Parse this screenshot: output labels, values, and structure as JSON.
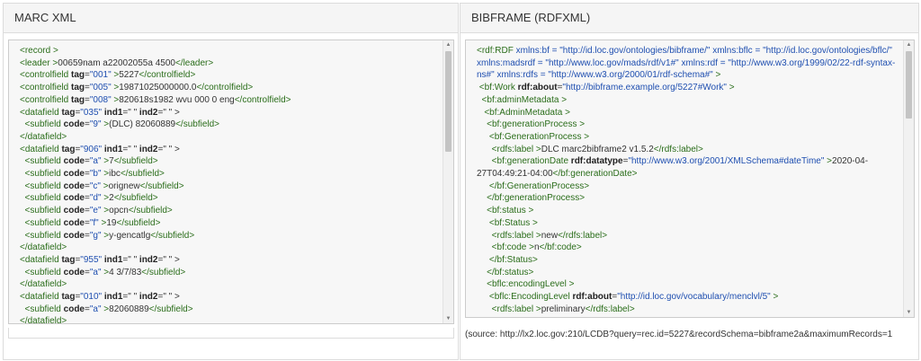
{
  "left": {
    "title": "MARC XML",
    "lines": [
      [
        [
          "t",
          "<record >"
        ]
      ],
      [
        [
          "t",
          "<leader >"
        ],
        [
          "x",
          "00659nam a22002055a 4500"
        ],
        [
          "t",
          "</leader>"
        ]
      ],
      [
        [
          "t",
          "<controlfield "
        ],
        [
          "a",
          "tag"
        ],
        [
          "x",
          "="
        ],
        [
          "v",
          "\"001\""
        ],
        [
          "t",
          " >"
        ],
        [
          "x",
          "5227"
        ],
        [
          "t",
          "</controlfield>"
        ]
      ],
      [
        [
          "t",
          "<controlfield "
        ],
        [
          "a",
          "tag"
        ],
        [
          "x",
          "="
        ],
        [
          "v",
          "\"005\""
        ],
        [
          "t",
          " >"
        ],
        [
          "x",
          "19871025000000.0"
        ],
        [
          "t",
          "</controlfield>"
        ]
      ],
      [
        [
          "t",
          "<controlfield "
        ],
        [
          "a",
          "tag"
        ],
        [
          "x",
          "="
        ],
        [
          "v",
          "\"008\""
        ],
        [
          "t",
          " >"
        ],
        [
          "x",
          "820618s1982 wvu 000 0 eng"
        ],
        [
          "t",
          "</controlfield>"
        ]
      ],
      [
        [
          "t",
          "<datafield "
        ],
        [
          "a",
          "tag"
        ],
        [
          "x",
          "="
        ],
        [
          "v",
          "\"035\""
        ],
        [
          "a",
          " ind1"
        ],
        [
          "x",
          "=\" \" "
        ],
        [
          "a",
          "ind2"
        ],
        [
          "x",
          "=\" \" >"
        ]
      ],
      [
        [
          "t",
          "  <subfield "
        ],
        [
          "a",
          "code"
        ],
        [
          "x",
          "="
        ],
        [
          "v",
          "\"9\""
        ],
        [
          "t",
          " >"
        ],
        [
          "x",
          "(DLC) 82060889"
        ],
        [
          "t",
          "</subfield>"
        ]
      ],
      [
        [
          "t",
          "</datafield>"
        ]
      ],
      [
        [
          "t",
          "<datafield "
        ],
        [
          "a",
          "tag"
        ],
        [
          "x",
          "="
        ],
        [
          "v",
          "\"906\""
        ],
        [
          "a",
          " ind1"
        ],
        [
          "x",
          "=\" \" "
        ],
        [
          "a",
          "ind2"
        ],
        [
          "x",
          "=\" \" >"
        ]
      ],
      [
        [
          "t",
          "  <subfield "
        ],
        [
          "a",
          "code"
        ],
        [
          "x",
          "="
        ],
        [
          "v",
          "\"a\""
        ],
        [
          "t",
          " >"
        ],
        [
          "x",
          "7"
        ],
        [
          "t",
          "</subfield>"
        ]
      ],
      [
        [
          "t",
          "  <subfield "
        ],
        [
          "a",
          "code"
        ],
        [
          "x",
          "="
        ],
        [
          "v",
          "\"b\""
        ],
        [
          "t",
          " >"
        ],
        [
          "x",
          "ibc"
        ],
        [
          "t",
          "</subfield>"
        ]
      ],
      [
        [
          "t",
          "  <subfield "
        ],
        [
          "a",
          "code"
        ],
        [
          "x",
          "="
        ],
        [
          "v",
          "\"c\""
        ],
        [
          "t",
          " >"
        ],
        [
          "x",
          "orignew"
        ],
        [
          "t",
          "</subfield>"
        ]
      ],
      [
        [
          "t",
          "  <subfield "
        ],
        [
          "a",
          "code"
        ],
        [
          "x",
          "="
        ],
        [
          "v",
          "\"d\""
        ],
        [
          "t",
          " >"
        ],
        [
          "x",
          "2"
        ],
        [
          "t",
          "</subfield>"
        ]
      ],
      [
        [
          "t",
          "  <subfield "
        ],
        [
          "a",
          "code"
        ],
        [
          "x",
          "="
        ],
        [
          "v",
          "\"e\""
        ],
        [
          "t",
          " >"
        ],
        [
          "x",
          "opcn"
        ],
        [
          "t",
          "</subfield>"
        ]
      ],
      [
        [
          "t",
          "  <subfield "
        ],
        [
          "a",
          "code"
        ],
        [
          "x",
          "="
        ],
        [
          "v",
          "\"f\""
        ],
        [
          "t",
          " >"
        ],
        [
          "x",
          "19"
        ],
        [
          "t",
          "</subfield>"
        ]
      ],
      [
        [
          "t",
          "  <subfield "
        ],
        [
          "a",
          "code"
        ],
        [
          "x",
          "="
        ],
        [
          "v",
          "\"g\""
        ],
        [
          "t",
          " >"
        ],
        [
          "x",
          "y-gencatlg"
        ],
        [
          "t",
          "</subfield>"
        ]
      ],
      [
        [
          "t",
          "</datafield>"
        ]
      ],
      [
        [
          "t",
          "<datafield "
        ],
        [
          "a",
          "tag"
        ],
        [
          "x",
          "="
        ],
        [
          "v",
          "\"955\""
        ],
        [
          "a",
          " ind1"
        ],
        [
          "x",
          "=\" \" "
        ],
        [
          "a",
          "ind2"
        ],
        [
          "x",
          "=\" \" >"
        ]
      ],
      [
        [
          "t",
          "  <subfield "
        ],
        [
          "a",
          "code"
        ],
        [
          "x",
          "="
        ],
        [
          "v",
          "\"a\""
        ],
        [
          "t",
          " >"
        ],
        [
          "x",
          "4 3/7/83"
        ],
        [
          "t",
          "</subfield>"
        ]
      ],
      [
        [
          "t",
          "</datafield>"
        ]
      ],
      [
        [
          "t",
          "<datafield "
        ],
        [
          "a",
          "tag"
        ],
        [
          "x",
          "="
        ],
        [
          "v",
          "\"010\""
        ],
        [
          "a",
          " ind1"
        ],
        [
          "x",
          "=\" \" "
        ],
        [
          "a",
          "ind2"
        ],
        [
          "x",
          "=\" \" >"
        ]
      ],
      [
        [
          "t",
          "  <subfield "
        ],
        [
          "a",
          "code"
        ],
        [
          "x",
          "="
        ],
        [
          "v",
          "\"a\""
        ],
        [
          "t",
          " >"
        ],
        [
          "x",
          "82060889"
        ],
        [
          "t",
          "</subfield>"
        ]
      ],
      [
        [
          "t",
          "</datafield>"
        ]
      ]
    ]
  },
  "right": {
    "title": "BIBFRAME (RDFXML)",
    "lines": [
      [
        [
          "t",
          "<rdf:RDF "
        ],
        [
          "v",
          "xmlns:bf = \"http://id.loc.gov/ontologies/bibframe/\" xmlns:bflc = \"http://id.loc.gov/ontologies/bflc/\" xmlns:madsrdf = \"http://www.loc.gov/mads/rdf/v1#\" xmlns:rdf = \"http://www.w3.org/1999/02/22-rdf-syntax-ns#\" xmlns:rdfs = \"http://www.w3.org/2000/01/rdf-schema#\""
        ],
        [
          "t",
          " >"
        ]
      ],
      [
        [
          "t",
          " <bf:Work "
        ],
        [
          "a",
          "rdf:about"
        ],
        [
          "x",
          "="
        ],
        [
          "v",
          "\"http://bibframe.example.org/5227#Work\""
        ],
        [
          "t",
          " >"
        ]
      ],
      [
        [
          "t",
          "  <bf:adminMetadata >"
        ]
      ],
      [
        [
          "t",
          "   <bf:AdminMetadata >"
        ]
      ],
      [
        [
          "t",
          "    <bf:generationProcess >"
        ]
      ],
      [
        [
          "t",
          "     <bf:GenerationProcess >"
        ]
      ],
      [
        [
          "t",
          "      <rdfs:label >"
        ],
        [
          "x",
          "DLC marc2bibframe2 v1.5.2"
        ],
        [
          "t",
          "</rdfs:label>"
        ]
      ],
      [
        [
          "t",
          "      <bf:generationDate "
        ],
        [
          "a",
          "rdf:datatype"
        ],
        [
          "x",
          "="
        ],
        [
          "v",
          "\"http://www.w3.org/2001/XMLSchema#dateTime\""
        ],
        [
          "t",
          " >"
        ],
        [
          "x",
          "2020-04-27T04:49:21-04:00"
        ],
        [
          "t",
          "</bf:generationDate>"
        ]
      ],
      [
        [
          "t",
          "     </bf:GenerationProcess>"
        ]
      ],
      [
        [
          "t",
          "    </bf:generationProcess>"
        ]
      ],
      [
        [
          "t",
          "    <bf:status >"
        ]
      ],
      [
        [
          "t",
          "     <bf:Status >"
        ]
      ],
      [
        [
          "t",
          "      <rdfs:label >"
        ],
        [
          "x",
          "new"
        ],
        [
          "t",
          "</rdfs:label>"
        ]
      ],
      [
        [
          "t",
          "      <bf:code >"
        ],
        [
          "x",
          "n"
        ],
        [
          "t",
          "</bf:code>"
        ]
      ],
      [
        [
          "t",
          "     </bf:Status>"
        ]
      ],
      [
        [
          "t",
          "    </bf:status>"
        ]
      ],
      [
        [
          "t",
          "    <bflc:encodingLevel >"
        ]
      ],
      [
        [
          "t",
          "     <bflc:EncodingLevel "
        ],
        [
          "a",
          "rdf:about"
        ],
        [
          "x",
          "="
        ],
        [
          "v",
          "\"http://id.loc.gov/vocabulary/menclvl/5\""
        ],
        [
          "t",
          " >"
        ]
      ],
      [
        [
          "t",
          "      <rdfs:label >"
        ],
        [
          "x",
          "preliminary"
        ],
        [
          "t",
          "</rdfs:label>"
        ]
      ]
    ],
    "source": "(source: http://lx2.loc.gov:210/LCDB?query=rec.id=5227&recordSchema=bibframe2a&maximumRecords=1"
  }
}
